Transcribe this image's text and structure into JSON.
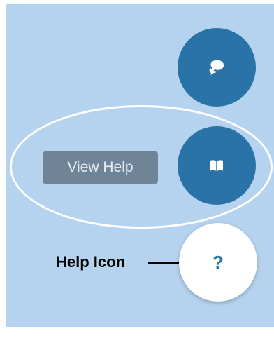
{
  "colors": {
    "background": "#b5d3ef",
    "fab_primary": "#2a73a8",
    "fab_secondary": "#ffffff",
    "tooltip_bg": "#6f8496",
    "highlight_outline": "#ffffff",
    "callout": "#000000"
  },
  "buttons": {
    "chat": {
      "icon": "chat-bubble-icon"
    },
    "view_help": {
      "icon": "book-icon",
      "tooltip": "View Help"
    },
    "help": {
      "icon": "question-mark-icon",
      "glyph": "?"
    }
  },
  "annotation": {
    "label": "Help Icon"
  }
}
